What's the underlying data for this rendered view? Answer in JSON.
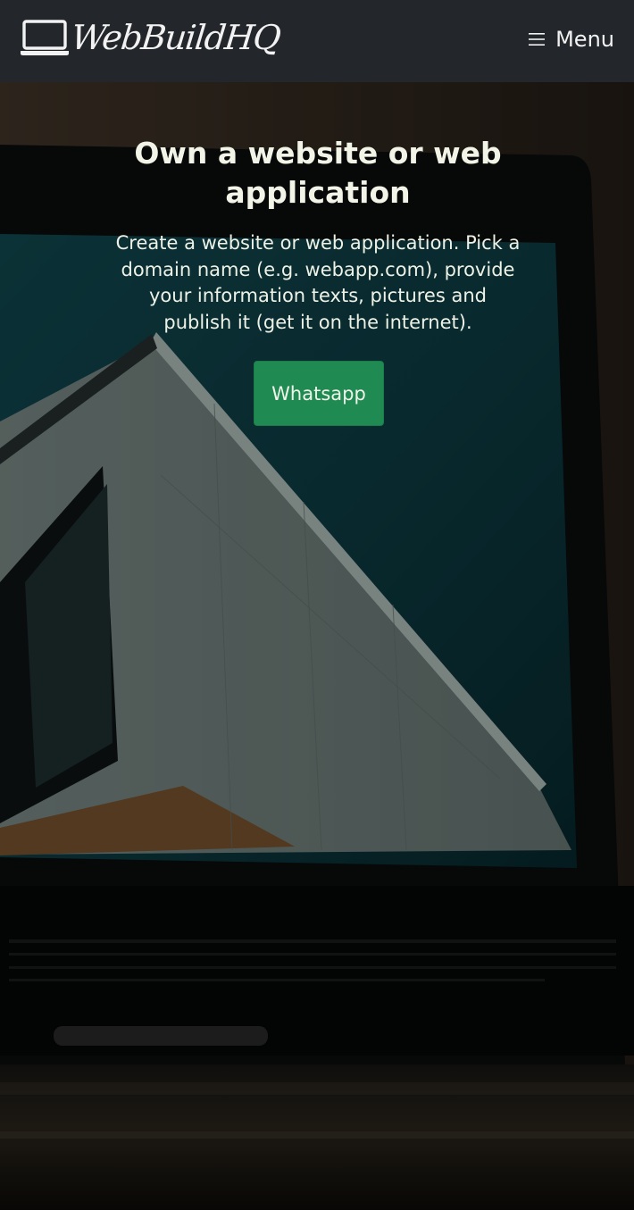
{
  "navbar": {
    "brand": "WebBuildHQ",
    "brand_icon": "laptop-icon",
    "menu_icon": "hamburger-icon",
    "menu_label": "Menu",
    "background": "#23272b"
  },
  "hero": {
    "title": "Own a website or web application",
    "description": "Create a website or web application. Pick a domain name (e.g. webapp.com), provide your information texts, pictures and publish it (get it on the internet).",
    "button_label": "Whatsapp",
    "button_color": "#1f8a52",
    "background_image": "laptop-screen-modern-building-photo"
  }
}
